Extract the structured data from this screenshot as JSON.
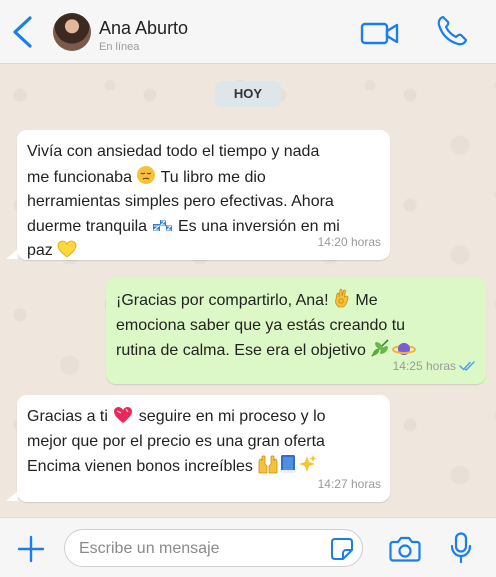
{
  "header": {
    "contact_name": "Ana Aburto",
    "contact_status": "En línea"
  },
  "chat": {
    "day_label": "HOY",
    "messages": [
      {
        "direction": "incoming",
        "parts": [
          "Vivía con ansiedad todo el tiempo y nada",
          "me funcionaba ",
          " Tu libro me dio",
          "herramientas simples pero efectivas. Ahora",
          "duerme tranquila ",
          " Es una inversión en mi",
          "paz "
        ],
        "time": "14:20 horas"
      },
      {
        "direction": "outgoing",
        "parts": [
          "¡Gracias por compartirlo, Ana! ",
          " Me",
          "emociona saber que ya estás creando tu",
          "rutina de calma. Ese era el objetivo "
        ],
        "time": "14:25 horas",
        "read": true
      },
      {
        "direction": "incoming",
        "parts": [
          "Gracias a ti ",
          " seguire en mi proceso y lo",
          "mejor que por el precio es una gran oferta",
          "Encima vienen bonos increíbles "
        ],
        "time": "14:27 horas"
      }
    ]
  },
  "composer": {
    "placeholder": "Escribe un mensaje"
  },
  "colors": {
    "accent": "#1a7ef0",
    "incoming_bubble": "#ffffff",
    "outgoing_bubble": "#dcf8c6",
    "read_ticks": "#4fa3e0"
  },
  "icons": [
    "back-arrow-icon",
    "video-call-icon",
    "phone-icon",
    "pensive-face-emoji",
    "sleeping-emoji",
    "yellow-heart-emoji",
    "ok-hand-emoji",
    "leaf-emoji",
    "saturn-emoji",
    "heart-emoji",
    "raised-hands-emoji",
    "book-emoji",
    "sparkles-emoji",
    "plus-icon",
    "sticker-icon",
    "camera-icon",
    "microphone-icon",
    "double-check-icon"
  ]
}
